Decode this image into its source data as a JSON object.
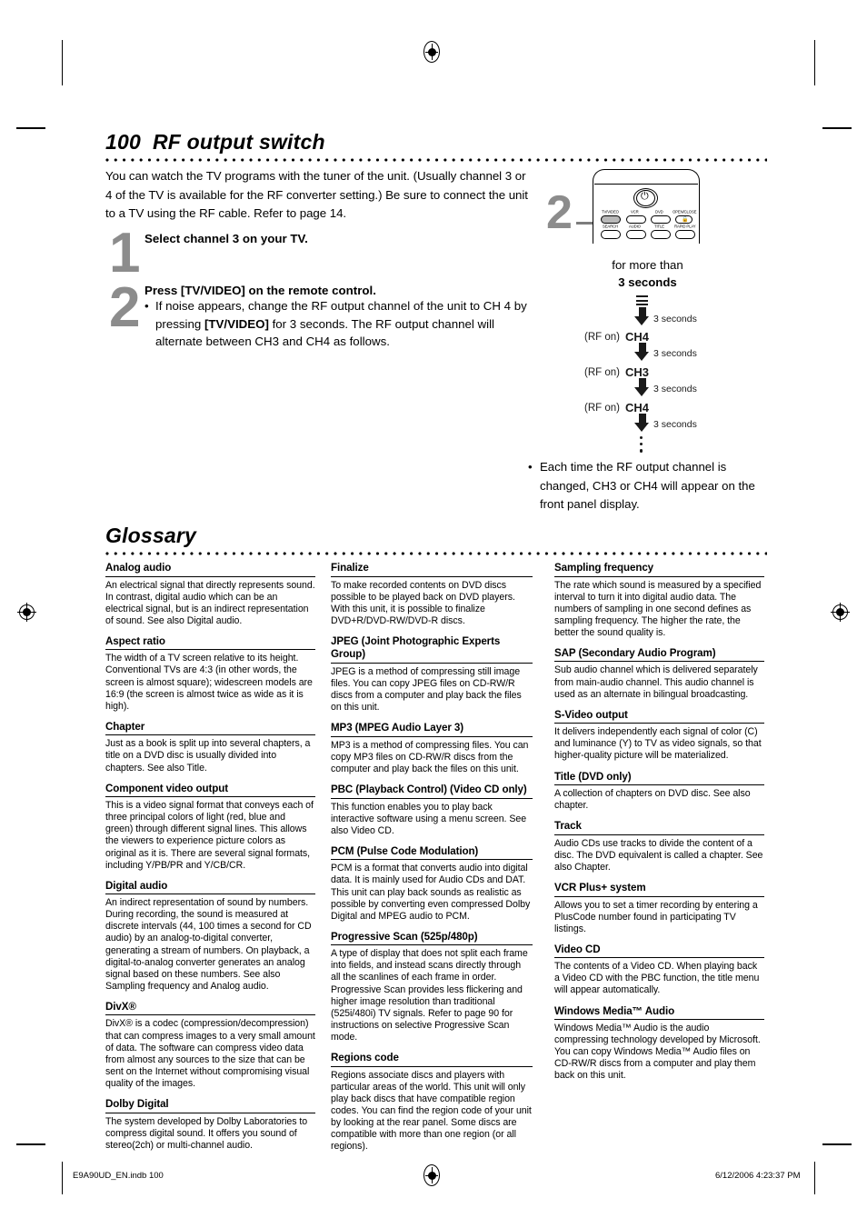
{
  "page": {
    "number": "100",
    "section_title": "RF output switch",
    "glossary_title": "Glossary"
  },
  "intro": {
    "text": "You can watch the TV programs with the tuner of the unit. (Usually channel 3 or 4 of the TV is available for the RF converter setting.) Be sure to connect the unit to a TV using the RF cable. Refer to page 14."
  },
  "steps": [
    {
      "number": "1",
      "heading": "Select channel 3 on your TV."
    },
    {
      "number": "2",
      "heading": "Press [TV/VIDEO] on the remote control.",
      "bullet_parts": {
        "p1": "If noise appears, change the RF output channel of the unit to CH 4 by pressing ",
        "bold": "[TV/VIDEO]",
        "p2": " for 3 seconds. The RF output channel will alternate between CH3 and CH4 as follows."
      }
    }
  ],
  "illustration": {
    "callout_number": "2",
    "note_line1": "for more than",
    "note_line2": "3 seconds",
    "remote_buttons_row1": [
      "TV/VIDEO",
      "VCR",
      "DVD",
      "OPEN/CLOSE"
    ],
    "remote_buttons_row2": [
      "SEARCH",
      "AUDIO",
      "TITLE",
      "RAPID PLAY"
    ],
    "power_icon": "power-icon",
    "lock_icon": "lock-icon"
  },
  "flow": {
    "steps": [
      {
        "seconds": "3 seconds",
        "rf": "(RF on)",
        "channel": "CH4"
      },
      {
        "seconds": "3 seconds",
        "rf": "(RF on)",
        "channel": "CH3"
      },
      {
        "seconds": "3 seconds",
        "rf": "(RF on)",
        "channel": "CH4"
      },
      {
        "seconds": "3 seconds",
        "rf": "",
        "channel": ""
      }
    ]
  },
  "right_note": {
    "bullet": "•",
    "text": "Each time the RF output channel is changed, CH3 or CH4 will appear on the front panel display."
  },
  "glossary": {
    "column1": [
      {
        "term": "Analog audio",
        "definition": "An electrical signal that directly represents sound. In contrast, digital audio which can be an electrical signal, but is an indirect representation of sound. See also Digital audio."
      },
      {
        "term": "Aspect ratio",
        "definition": "The width of a TV screen relative to its height. Conventional TVs are 4:3 (in other words, the screen is almost square); widescreen models are 16:9 (the screen is almost twice as wide as it is high)."
      },
      {
        "term": "Chapter",
        "definition": "Just as a book is split up into several chapters, a title on a DVD disc is usually divided into chapters. See also Title."
      },
      {
        "term": "Component video output",
        "definition": "This is a video signal format that conveys each of three principal colors of light (red, blue and green) through different signal lines. This allows the viewers to experience picture colors as original as it is. There are several signal formats, including Y/PB/PR and Y/CB/CR."
      },
      {
        "term": "Digital audio",
        "definition": "An indirect representation of sound by numbers. During recording, the sound is measured at discrete intervals (44, 100 times a second for CD audio) by an analog-to-digital converter, generating a stream of numbers. On playback, a digital-to-analog converter generates an analog signal based on these numbers. See also Sampling frequency and Analog audio."
      },
      {
        "term": "DivX®",
        "definition": "DivX® is a codec (compression/decompression) that can compress images to a very small amount of data. The software can compress video data from almost any sources to the size that can be sent on the Internet without compromising visual quality of the images."
      },
      {
        "term": "Dolby Digital",
        "definition": "The system developed by Dolby Laboratories to compress digital sound. It offers you sound of stereo(2ch) or multi-channel audio."
      }
    ],
    "column2": [
      {
        "term": "Finalize",
        "definition": "To make recorded contents on DVD discs possible to be played back on DVD players. With this unit, it is possible to finalize DVD+R/DVD-RW/DVD-R discs."
      },
      {
        "term": "JPEG (Joint Photographic Experts Group)",
        "definition": "JPEG is a method of compressing still image files. You can copy JPEG files on CD-RW/R discs from a computer and play back the files on this unit."
      },
      {
        "term": "MP3 (MPEG Audio Layer 3)",
        "definition": "MP3 is a method of compressing files. You can copy MP3 files on CD-RW/R discs from the computer and play back the files on this unit."
      },
      {
        "term": "PBC (Playback Control) (Video CD only)",
        "definition": "This function enables you to play back interactive software using a menu screen. See also Video CD."
      },
      {
        "term": "PCM (Pulse Code Modulation)",
        "definition": "PCM is a format that converts audio into digital data. It is mainly used for Audio CDs and DAT. This unit can play back sounds as realistic as possible by converting even compressed Dolby Digital and MPEG audio to PCM."
      },
      {
        "term": "Progressive Scan (525p/480p)",
        "definition": "A type of display that does not split each frame into fields, and instead scans directly through all the scanlines of each frame in order. Progressive Scan provides less flickering and higher image resolution than traditional (525i/480i) TV signals. Refer to page 90 for instructions on selective Progressive Scan mode."
      },
      {
        "term": "Regions code",
        "definition": "Regions associate discs and players with particular areas of the world. This unit will only play back discs that have compatible region codes. You can find the region code of your unit by looking at the rear panel. Some discs are compatible with more than one region (or all regions)."
      }
    ],
    "column3": [
      {
        "term": "Sampling frequency",
        "definition": "The rate which sound is measured by a specified interval to turn it into digital audio data. The numbers of sampling in one second defines as sampling frequency. The higher the rate, the better the sound quality is."
      },
      {
        "term": "SAP (Secondary Audio Program)",
        "definition": "Sub audio channel which is delivered separately from main-audio channel. This audio channel is used as an alternate in bilingual broadcasting."
      },
      {
        "term": "S-Video output",
        "definition": "It delivers independently each signal of color (C) and luminance (Y) to TV as video signals, so that higher-quality picture will be materialized."
      },
      {
        "term": "Title (DVD only)",
        "definition": "A collection of chapters on DVD disc. See also chapter."
      },
      {
        "term": "Track",
        "definition": "Audio CDs use tracks to divide the content of a disc. The DVD equivalent is called a chapter. See also Chapter."
      },
      {
        "term": "VCR Plus+ system",
        "definition": "Allows you to set a timer recording by entering a PlusCode number found in participating TV listings."
      },
      {
        "term": "Video CD",
        "definition": "The contents of a Video CD. When playing back a Video CD with the PBC function, the title menu will appear automatically."
      },
      {
        "term": "Windows Media™ Audio",
        "definition": "Windows Media™ Audio is the audio compressing technology developed by Microsoft. You can copy Windows Media™ Audio files on CD-RW/R discs from a computer and play them back on this unit."
      }
    ]
  },
  "footer": {
    "left": "E9A90UD_EN.indb   100",
    "right": "6/12/2006   4:23:37 PM"
  }
}
